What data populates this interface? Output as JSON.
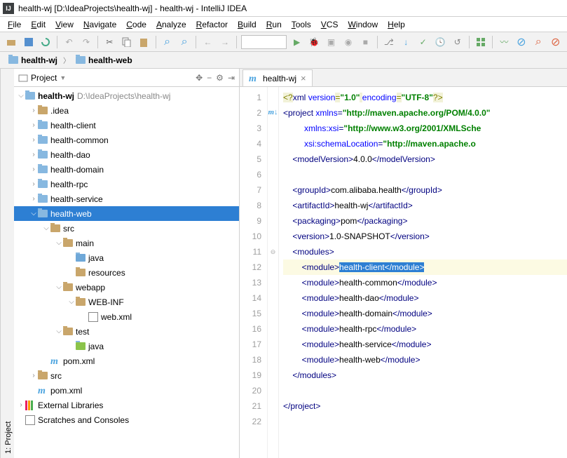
{
  "title": "health-wj [D:\\IdeaProjects\\health-wj] - health-wj - IntelliJ IDEA",
  "menu": [
    "File",
    "Edit",
    "View",
    "Navigate",
    "Code",
    "Analyze",
    "Refactor",
    "Build",
    "Run",
    "Tools",
    "VCS",
    "Window",
    "Help"
  ],
  "breadcrumb": [
    "health-wj",
    "health-web"
  ],
  "sidetab": "1: Project",
  "projectHeader": "Project",
  "editorTab": "health-wj",
  "tree": [
    {
      "d": 0,
      "a": "v",
      "i": "folder",
      "t": "health-wj",
      "suf": "D:\\IdeaProjects\\health-wj",
      "sel": false
    },
    {
      "d": 1,
      "a": ">",
      "i": "plain",
      "t": ".idea"
    },
    {
      "d": 1,
      "a": ">",
      "i": "folder",
      "t": "health-client"
    },
    {
      "d": 1,
      "a": ">",
      "i": "folder",
      "t": "health-common"
    },
    {
      "d": 1,
      "a": ">",
      "i": "folder",
      "t": "health-dao"
    },
    {
      "d": 1,
      "a": ">",
      "i": "folder",
      "t": "health-domain"
    },
    {
      "d": 1,
      "a": ">",
      "i": "folder",
      "t": "health-rpc"
    },
    {
      "d": 1,
      "a": ">",
      "i": "folder",
      "t": "health-service"
    },
    {
      "d": 1,
      "a": "v",
      "i": "folder",
      "t": "health-web",
      "sel": true
    },
    {
      "d": 2,
      "a": "v",
      "i": "plain",
      "t": "src"
    },
    {
      "d": 3,
      "a": "v",
      "i": "plain",
      "t": "main"
    },
    {
      "d": 4,
      "a": "",
      "i": "java",
      "t": "java"
    },
    {
      "d": 4,
      "a": "",
      "i": "plain",
      "t": "resources"
    },
    {
      "d": 3,
      "a": "v",
      "i": "plain",
      "t": "webapp"
    },
    {
      "d": 4,
      "a": "v",
      "i": "plain",
      "t": "WEB-INF"
    },
    {
      "d": 5,
      "a": "",
      "i": "file",
      "t": "web.xml"
    },
    {
      "d": 3,
      "a": "v",
      "i": "plain",
      "t": "test"
    },
    {
      "d": 4,
      "a": "",
      "i": "javag",
      "t": "java"
    },
    {
      "d": 2,
      "a": "",
      "i": "maven",
      "t": "pom.xml"
    },
    {
      "d": 1,
      "a": ">",
      "i": "plain",
      "t": "src"
    },
    {
      "d": 1,
      "a": "",
      "i": "maven",
      "t": "pom.xml"
    },
    {
      "d": 0,
      "a": ">",
      "i": "lib",
      "t": "External Libraries"
    },
    {
      "d": 0,
      "a": "",
      "i": "scratch",
      "t": "Scratches and Consoles"
    }
  ],
  "lines": 22,
  "code": [
    {
      "n": 1,
      "seg": [
        [
          "pi",
          "<?"
        ],
        [
          "tag",
          "xml "
        ],
        [
          "attr",
          "version"
        ],
        [
          "pi",
          "="
        ],
        [
          "str",
          "\"1.0\""
        ],
        [
          "pi",
          " "
        ],
        [
          "attr",
          "encoding"
        ],
        [
          "pi",
          "="
        ],
        [
          "str",
          "\"UTF-8\""
        ],
        [
          "pi",
          "?>"
        ]
      ]
    },
    {
      "n": 2,
      "seg": [
        [
          "tag",
          "<project "
        ],
        [
          "attr",
          "xmlns"
        ],
        [
          "tag",
          "="
        ],
        [
          "str",
          "\"http://maven.apache.org/POM/4.0.0\""
        ]
      ]
    },
    {
      "n": 3,
      "seg": [
        [
          "tag",
          "         "
        ],
        [
          "attr",
          "xmlns:xsi"
        ],
        [
          "tag",
          "="
        ],
        [
          "str",
          "\"http://www.w3.org/2001/XMLSche"
        ]
      ]
    },
    {
      "n": 4,
      "seg": [
        [
          "tag",
          "         "
        ],
        [
          "attr",
          "xsi:schemaLocation"
        ],
        [
          "tag",
          "="
        ],
        [
          "str",
          "\"http://maven.apache.o"
        ]
      ]
    },
    {
      "n": 5,
      "seg": [
        [
          "tag",
          "    <modelVersion>"
        ],
        [
          "txt",
          "4.0.0"
        ],
        [
          "tag",
          "</modelVersion>"
        ]
      ]
    },
    {
      "n": 6,
      "seg": [
        [
          "txt",
          ""
        ]
      ]
    },
    {
      "n": 7,
      "seg": [
        [
          "tag",
          "    <groupId>"
        ],
        [
          "txt",
          "com.alibaba.health"
        ],
        [
          "tag",
          "</groupId>"
        ]
      ]
    },
    {
      "n": 8,
      "seg": [
        [
          "tag",
          "    <artifactId>"
        ],
        [
          "txt",
          "health-wj"
        ],
        [
          "tag",
          "</artifactId>"
        ]
      ]
    },
    {
      "n": 9,
      "seg": [
        [
          "tag",
          "    <packaging>"
        ],
        [
          "txt",
          "pom"
        ],
        [
          "tag",
          "</packaging>"
        ]
      ]
    },
    {
      "n": 10,
      "seg": [
        [
          "tag",
          "    <version>"
        ],
        [
          "txt",
          "1.0-SNAPSHOT"
        ],
        [
          "tag",
          "</version>"
        ]
      ]
    },
    {
      "n": 11,
      "seg": [
        [
          "tag",
          "    <modules>"
        ]
      ]
    },
    {
      "n": 12,
      "hl": true,
      "sel": true,
      "seg": [
        [
          "tag",
          "        <module>"
        ],
        [
          "txt",
          "health-client"
        ],
        [
          "tag",
          "</module>"
        ]
      ]
    },
    {
      "n": 13,
      "seg": [
        [
          "tag",
          "        <module>"
        ],
        [
          "txt",
          "health-common"
        ],
        [
          "tag",
          "</module>"
        ]
      ]
    },
    {
      "n": 14,
      "seg": [
        [
          "tag",
          "        <module>"
        ],
        [
          "txt",
          "health-dao"
        ],
        [
          "tag",
          "</module>"
        ]
      ]
    },
    {
      "n": 15,
      "seg": [
        [
          "tag",
          "        <module>"
        ],
        [
          "txt",
          "health-domain"
        ],
        [
          "tag",
          "</module>"
        ]
      ]
    },
    {
      "n": 16,
      "seg": [
        [
          "tag",
          "        <module>"
        ],
        [
          "txt",
          "health-rpc"
        ],
        [
          "tag",
          "</module>"
        ]
      ]
    },
    {
      "n": 17,
      "seg": [
        [
          "tag",
          "        <module>"
        ],
        [
          "txt",
          "health-service"
        ],
        [
          "tag",
          "</module>"
        ]
      ]
    },
    {
      "n": 18,
      "seg": [
        [
          "tag",
          "        <module>"
        ],
        [
          "txt",
          "health-web"
        ],
        [
          "tag",
          "</module>"
        ]
      ]
    },
    {
      "n": 19,
      "seg": [
        [
          "tag",
          "    </modules>"
        ]
      ]
    },
    {
      "n": 20,
      "seg": [
        [
          "txt",
          ""
        ]
      ]
    },
    {
      "n": 21,
      "seg": [
        [
          "tag",
          "</project>"
        ]
      ]
    },
    {
      "n": 22,
      "seg": [
        [
          "txt",
          ""
        ]
      ]
    }
  ]
}
